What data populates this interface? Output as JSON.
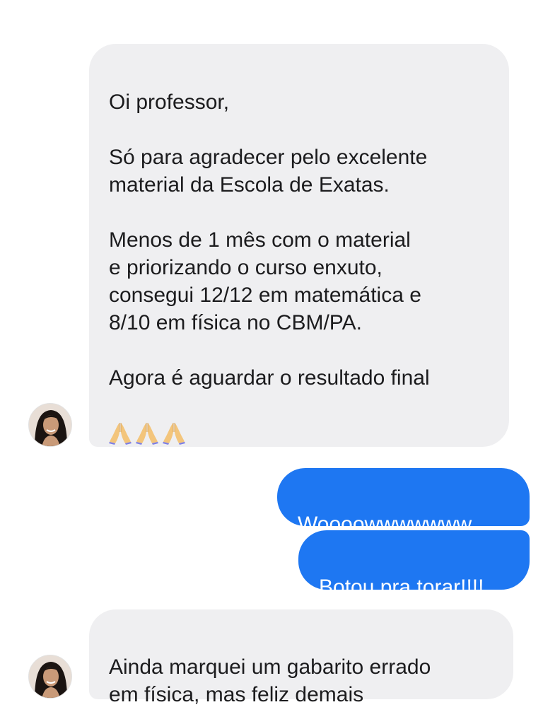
{
  "conversation": {
    "messages": [
      {
        "sender": "contact",
        "text": "Oi professor,\n\nSó para agradecer pelo excelente\nmaterial da Escola de Exatas.\n\nMenos de 1 mês com o material\ne priorizando o curso enxuto,\nconsegui 12/12 em matemática e\n8/10 em física no CBM/PA.\n\nAgora é aguardar o resultado final",
        "emoji": [
          "folded-hands-icon",
          "folded-hands-icon",
          "folded-hands-icon"
        ]
      },
      {
        "sender": "me",
        "text": "Woooowwwwwww"
      },
      {
        "sender": "me",
        "text": "Botou pra torar!!!!"
      },
      {
        "sender": "contact",
        "text": "Ainda marquei um gabarito errado\nem física, mas feliz demais"
      }
    ]
  },
  "colors": {
    "incoming_bubble": "#efeff1",
    "outgoing_bubble": "#1e77f2",
    "incoming_text": "#1c1c1e",
    "outgoing_text": "#ffffff"
  }
}
